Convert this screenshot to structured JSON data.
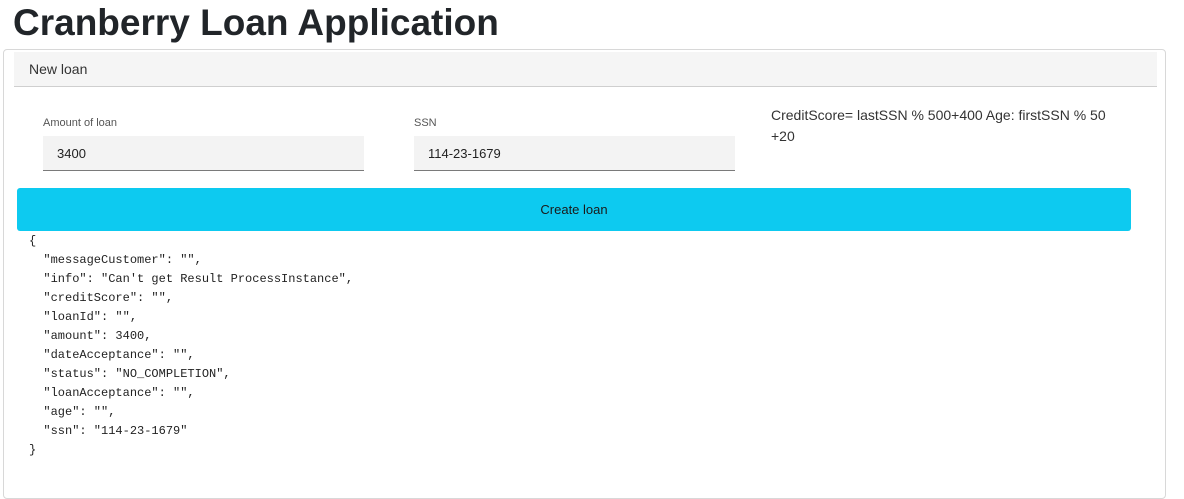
{
  "page": {
    "title": "Cranberry Loan Application"
  },
  "card": {
    "header": "New loan"
  },
  "form": {
    "amount": {
      "label": "Amount of loan",
      "value": "3400"
    },
    "ssn": {
      "label": "SSN",
      "value": "114-23-1679"
    },
    "formula_note": "CreditScore= lastSSN % 500+400 Age: firstSSN % 50 +20",
    "create_label": "Create loan"
  },
  "result": {
    "json_text": "{\n  \"messageCustomer\": \"\",\n  \"info\": \"Can't get Result ProcessInstance\",\n  \"creditScore\": \"\",\n  \"loanId\": \"\",\n  \"amount\": 3400,\n  \"dateAcceptance\": \"\",\n  \"status\": \"NO_COMPLETION\",\n  \"loanAcceptance\": \"\",\n  \"age\": \"\",\n  \"ssn\": \"114-23-1679\"\n}"
  },
  "colors": {
    "button": "#0dcaf0",
    "header_bg": "#f5f5f5",
    "input_bg": "#f3f3f3"
  }
}
